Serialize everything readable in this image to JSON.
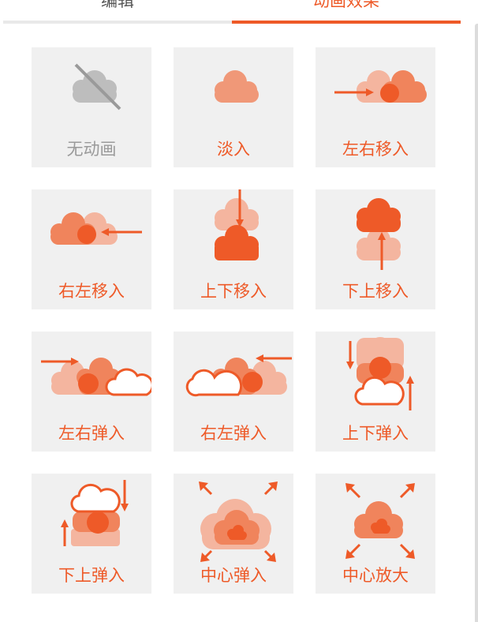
{
  "tabs": [
    {
      "label": "编辑"
    },
    {
      "label": "动画效果"
    }
  ],
  "colors": {
    "accent": "#ee5a28",
    "light": "#f4b59f",
    "mid": "#f0845c",
    "disabled": "#bdbdbd",
    "tile_bg": "#f0f0f0"
  },
  "animations": [
    {
      "label": "无动画",
      "icon": "no-animation-icon"
    },
    {
      "label": "淡入",
      "icon": "fade-in-icon"
    },
    {
      "label": "左右移入",
      "icon": "move-in-left-right-icon"
    },
    {
      "label": "右左移入",
      "icon": "move-in-right-left-icon"
    },
    {
      "label": "上下移入",
      "icon": "move-in-top-down-icon"
    },
    {
      "label": "下上移入",
      "icon": "move-in-bottom-up-icon"
    },
    {
      "label": "左右弹入",
      "icon": "bounce-in-left-right-icon"
    },
    {
      "label": "右左弹入",
      "icon": "bounce-in-right-left-icon"
    },
    {
      "label": "上下弹入",
      "icon": "bounce-in-top-down-icon"
    },
    {
      "label": "下上弹入",
      "icon": "bounce-in-bottom-up-icon"
    },
    {
      "label": "中心弹入",
      "icon": "center-bounce-in-icon"
    },
    {
      "label": "中心放大",
      "icon": "center-zoom-icon"
    }
  ]
}
